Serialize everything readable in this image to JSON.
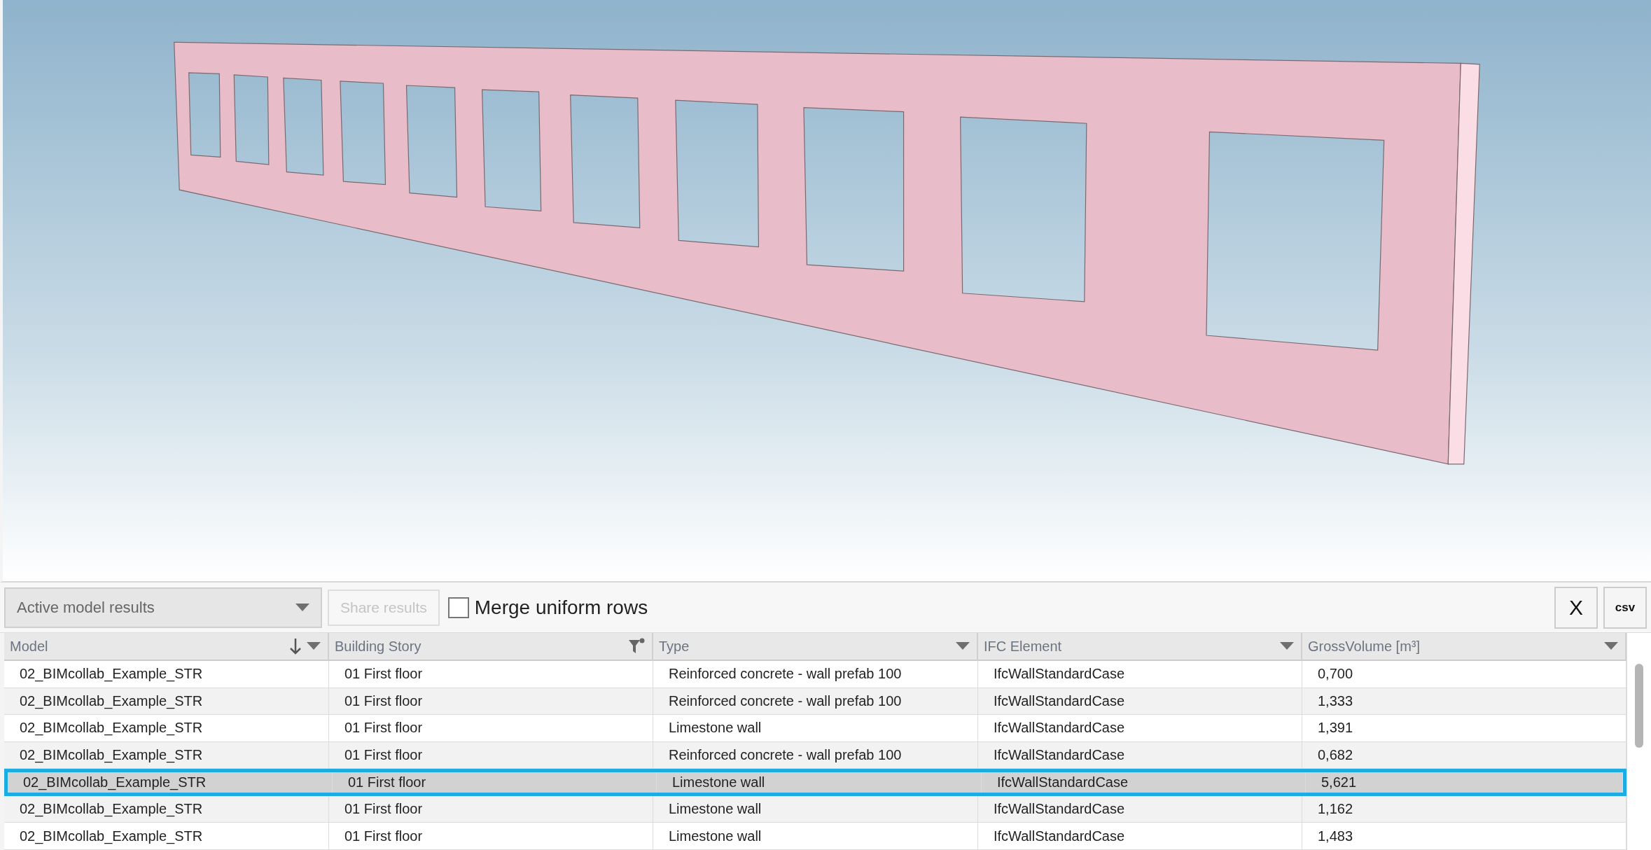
{
  "toolbar": {
    "results_dropdown": "Active model results",
    "share_button": {
      "label": "Share results",
      "disabled": true
    },
    "merge_checkbox": {
      "label": "Merge uniform rows",
      "checked": false
    },
    "buttons": [
      "X",
      "csv"
    ]
  },
  "table": {
    "columns": [
      {
        "label": "Model",
        "kind": "sorted"
      },
      {
        "label": "Building Story",
        "kind": "filtered"
      },
      {
        "label": "Type",
        "kind": "plain"
      },
      {
        "label": "IFC Element",
        "kind": "plain"
      },
      {
        "label": "GrossVolume [m³]",
        "kind": "plain"
      }
    ],
    "rows": [
      {
        "cells": [
          "02_BIMcollab_Example_STR",
          "01 First floor",
          "Reinforced concrete - wall prefab 100",
          "IfcWallStandardCase",
          "0,700"
        ],
        "selected": false
      },
      {
        "cells": [
          "02_BIMcollab_Example_STR",
          "01 First floor",
          "Reinforced concrete - wall prefab 100",
          "IfcWallStandardCase",
          "1,333"
        ],
        "selected": false
      },
      {
        "cells": [
          "02_BIMcollab_Example_STR",
          "01 First floor",
          "Limestone wall",
          "IfcWallStandardCase",
          "1,391"
        ],
        "selected": false
      },
      {
        "cells": [
          "02_BIMcollab_Example_STR",
          "01 First floor",
          "Reinforced concrete - wall prefab 100",
          "IfcWallStandardCase",
          "0,682"
        ],
        "selected": false
      },
      {
        "cells": [
          "02_BIMcollab_Example_STR",
          "01 First floor",
          "Limestone wall",
          "IfcWallStandardCase",
          "5,621"
        ],
        "selected": true
      },
      {
        "cells": [
          "02_BIMcollab_Example_STR",
          "01 First floor",
          "Limestone wall",
          "IfcWallStandardCase",
          "1,162"
        ],
        "selected": false
      },
      {
        "cells": [
          "02_BIMcollab_Example_STR",
          "01 First floor",
          "Limestone wall",
          "IfcWallStandardCase",
          "1,483"
        ],
        "selected": false
      }
    ]
  }
}
